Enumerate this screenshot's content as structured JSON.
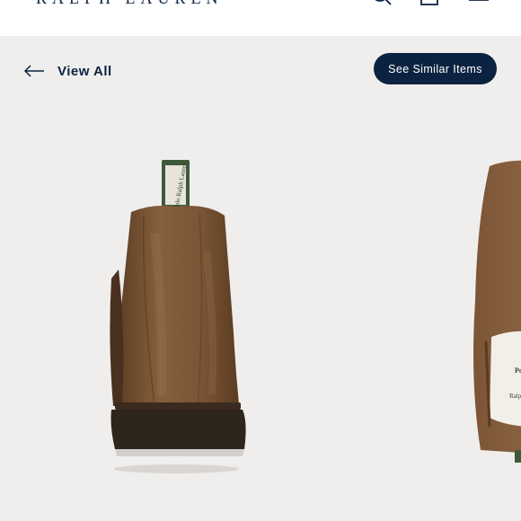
{
  "header": {
    "brand": "RALPH LAUREN",
    "icons": [
      "search-icon",
      "bag-icon",
      "menu-icon"
    ]
  },
  "toolbar": {
    "back_label": "View All",
    "similar_label": "See Similar Items"
  },
  "gallery": {
    "images": [
      {
        "name": "suede chelsea boot rear view"
      },
      {
        "name": "suede chelsea boot side view"
      }
    ],
    "pull_tab_text": "Polo Ralph Lauren",
    "insole_text": "Polo Ralph Lauren"
  },
  "colors": {
    "navy": "#0b2340",
    "background": "#efeeed",
    "suede": "#7a5434",
    "sole": "#2e251d"
  }
}
